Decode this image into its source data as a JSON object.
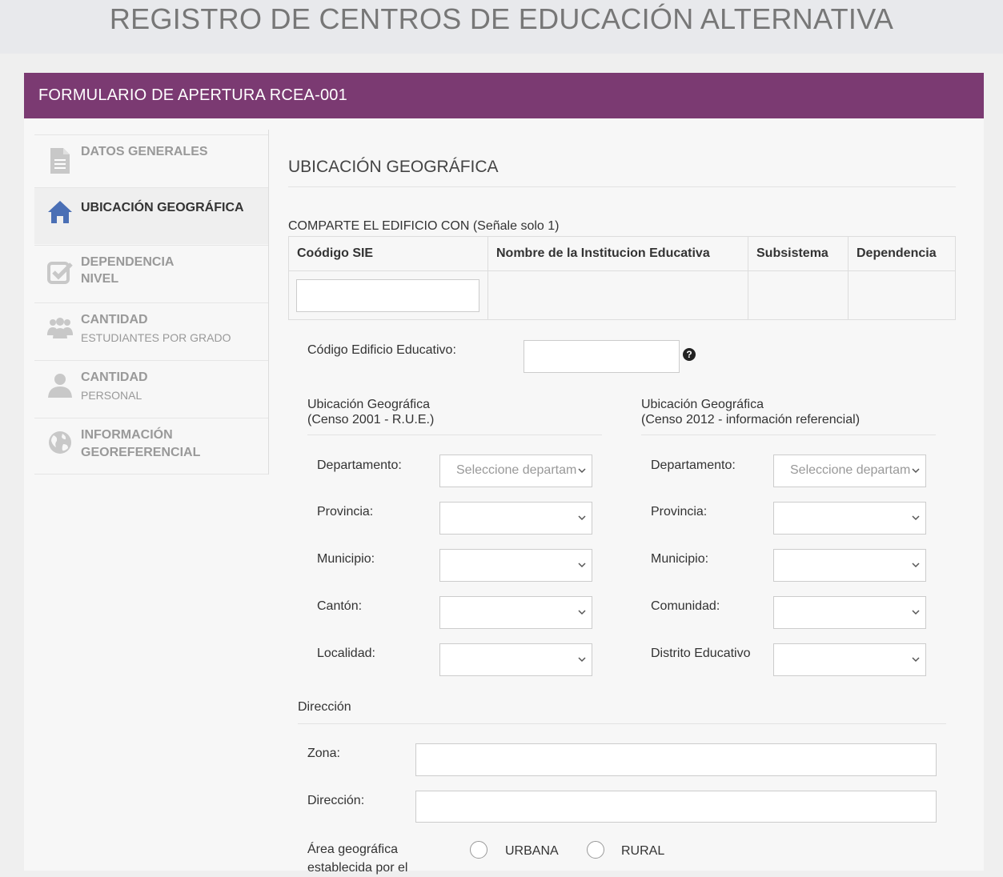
{
  "page_title": "REGISTRO DE CENTROS DE EDUCACIÓN ALTERNATIVA",
  "form_title": "FORMULARIO DE APERTURA RCEA-001",
  "accent_color": "#7b3a72",
  "sidebar": {
    "items": [
      {
        "title": "DATOS GENERALES",
        "subtitle": "",
        "icon": "document-icon"
      },
      {
        "title": "UBICACIÓN GEOGRÁFICA",
        "subtitle": "",
        "icon": "home-icon",
        "active": true
      },
      {
        "title": "DEPENDENCIA",
        "subtitle": "NIVEL",
        "icon": "checkbox-icon"
      },
      {
        "title": "CANTIDAD",
        "subtitle": "ESTUDIANTES POR GRADO",
        "icon": "users-icon"
      },
      {
        "title": "CANTIDAD",
        "subtitle": "PERSONAL",
        "icon": "user-icon"
      },
      {
        "title": "INFORMACIÓN",
        "subtitle": "GEOREFERENCIAL",
        "icon": "globe-icon"
      }
    ]
  },
  "main": {
    "section_title": "UBICACIÓN GEOGRÁFICA",
    "share_label": "COMPARTE EL EDIFICIO CON (Señale solo 1)",
    "share_table": {
      "headers": [
        "Coódigo SIE",
        "Nombre de la Institucion Educativa",
        "Subsistema",
        "Dependencia"
      ]
    },
    "edificio_label": "Código Edificio Educativo:",
    "help_icon": "question-circle-icon",
    "left_block": {
      "heading_line1": "Ubicación Geográfica",
      "heading_line2": "(Censo 2001 - R.U.E.)",
      "fields": [
        "Departamento:",
        "Provincia:",
        "Municipio:",
        "Cantón:",
        "Localidad:"
      ],
      "first_placeholder": "Seleccione departamento"
    },
    "right_block": {
      "heading_line1": "Ubicación Geográfica",
      "heading_line2": "(Censo 2012 - información referencial)",
      "fields": [
        "Departamento:",
        "Provincia:",
        "Municipio:",
        "Comunidad:",
        "Distrito Educativo"
      ],
      "first_placeholder": "Seleccione departamento"
    },
    "direccion_heading": "Dirección",
    "zona_label": "Zona:",
    "direccion_label": "Dirección:",
    "area_label_line1": "Área geográfica",
    "area_label_line2": "establecida por el",
    "radio_urbana": "URBANA",
    "radio_rural": "RURAL"
  }
}
